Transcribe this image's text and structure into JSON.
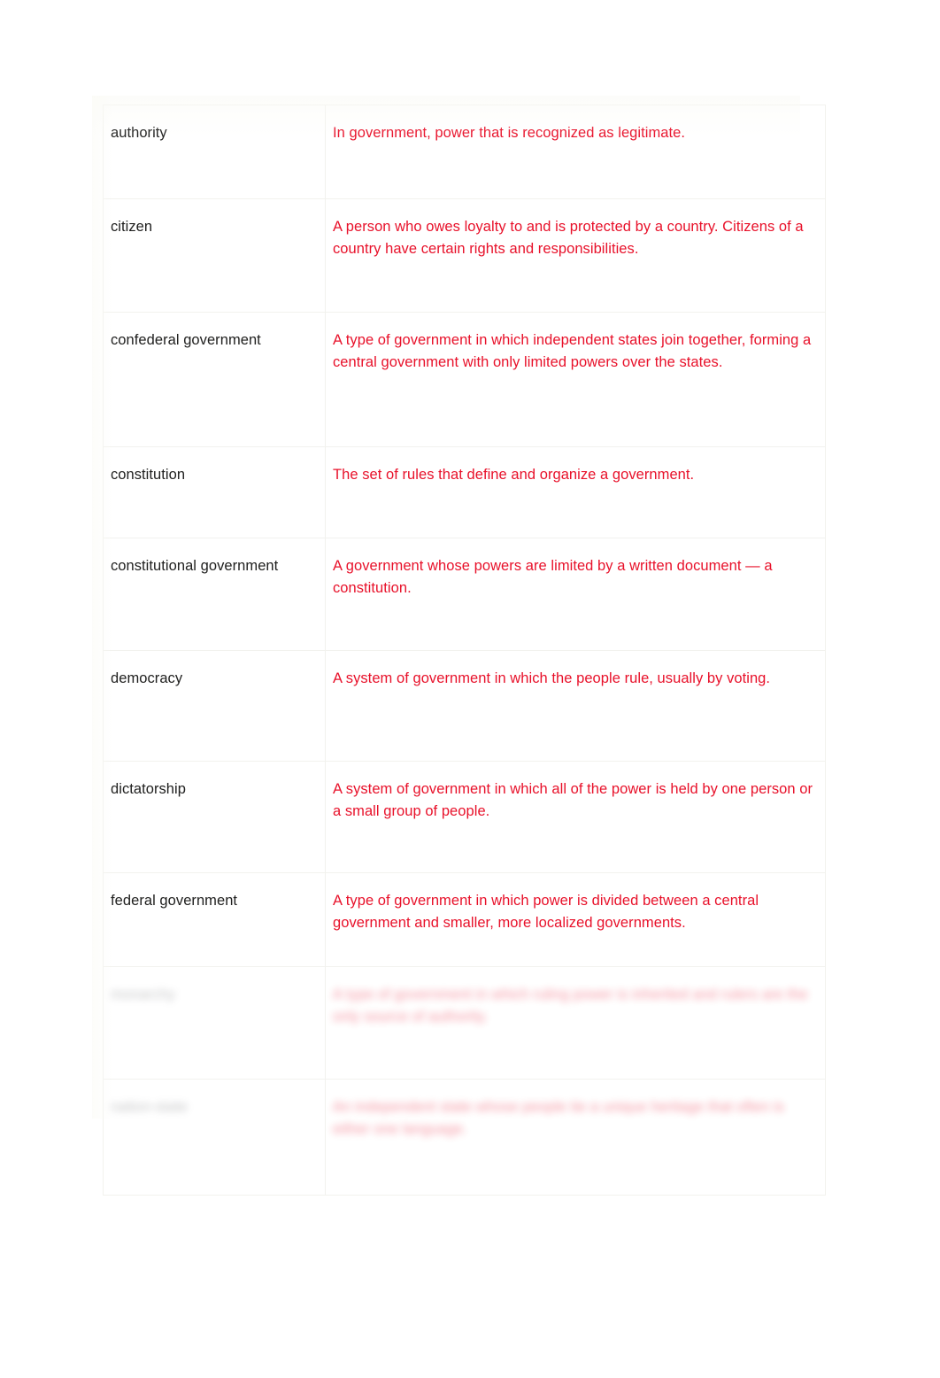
{
  "document": {
    "type": "glossary-table",
    "columns": [
      "term",
      "definition"
    ],
    "accent_color": "#e8112a",
    "term_color": "#20201f",
    "background_color": "#ffffff"
  },
  "rows": [
    {
      "term": "authority",
      "definition": "In government, power that is recognized as legitimate.",
      "obscured": false
    },
    {
      "term": "citizen",
      "definition": "A person who owes loyalty to and is protected by a country. Citizens of a country have certain rights and responsibilities.",
      "obscured": false
    },
    {
      "term": "confederal government",
      "definition": "A type of government in which independent states join together, forming a central government with only limited powers over the states.",
      "obscured": false
    },
    {
      "term": "constitution",
      "definition": "The set of rules that define and organize a government.",
      "obscured": false
    },
    {
      "term": "constitutional government",
      "definition": "A government whose powers are limited by a written document — a constitution.",
      "obscured": false
    },
    {
      "term": "democracy",
      "definition": "A system of government in which the people rule, usually by voting.",
      "obscured": false
    },
    {
      "term": "dictatorship",
      "definition": "A system of government in which all of the power is held by one person or a small group of people.",
      "obscured": false
    },
    {
      "term": "federal government",
      "definition": "A type of government in which power is divided between a central government and smaller, more localized governments.",
      "obscured": false
    },
    {
      "term": "monarchy",
      "definition": "A type of government in which ruling power is inherited and rulers are the only source of authority.",
      "obscured": true
    },
    {
      "term": "nation-state",
      "definition": "An independent state whose people tie a unique heritage that often is either one language.",
      "obscured": true
    }
  ]
}
